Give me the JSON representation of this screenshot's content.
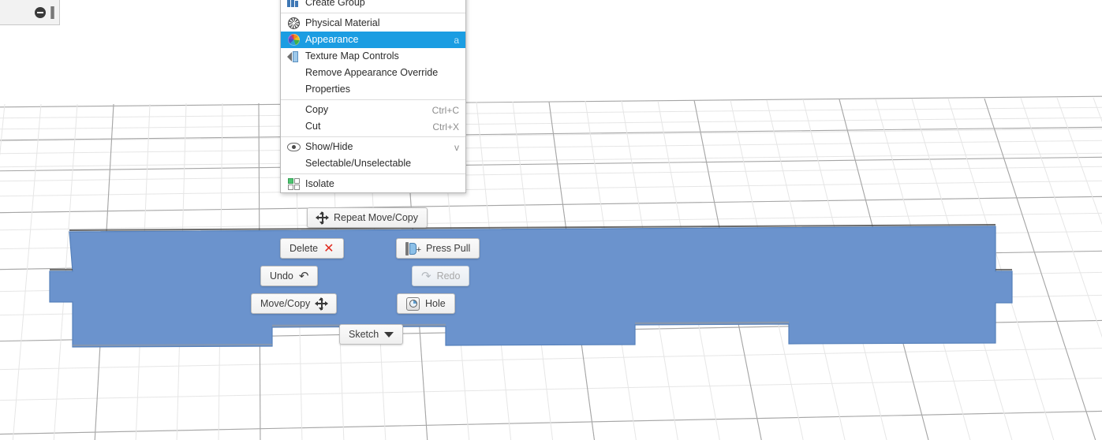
{
  "app": {
    "scene_background": "#ffffff",
    "body_fill": "#6b93cd",
    "body_edge": "#4a6fa5",
    "grid_minor_color": "#e3e3e3",
    "grid_major_color": "#9a9a9a",
    "accent_highlight": "#1b9de2"
  },
  "mini_toolbar": {
    "name": "selection-toolbar",
    "minus_icon": "minus-circle-icon",
    "caret_icon": "text-caret-icon"
  },
  "context_menu": {
    "name": "body-context-menu",
    "items": [
      {
        "label": "Create Group",
        "accel": "",
        "icon": "create-group-icon",
        "selected": false,
        "separator_after": true
      },
      {
        "label": "Physical Material",
        "accel": "",
        "icon": "physical-material-icon",
        "selected": false,
        "separator_after": false
      },
      {
        "label": "Appearance",
        "accel": "a",
        "icon": "appearance-icon",
        "selected": true,
        "separator_after": false
      },
      {
        "label": "Texture Map Controls",
        "accel": "",
        "icon": "texture-map-icon",
        "selected": false,
        "separator_after": false
      },
      {
        "label": "Remove Appearance Override",
        "accel": "",
        "icon": "",
        "selected": false,
        "separator_after": false
      },
      {
        "label": "Properties",
        "accel": "",
        "icon": "",
        "selected": false,
        "separator_after": true
      },
      {
        "label": "Copy",
        "accel": "Ctrl+C",
        "icon": "",
        "selected": false,
        "separator_after": false
      },
      {
        "label": "Cut",
        "accel": "Ctrl+X",
        "icon": "",
        "selected": false,
        "separator_after": true
      },
      {
        "label": "Show/Hide",
        "accel": "v",
        "icon": "eye-icon",
        "selected": false,
        "separator_after": false
      },
      {
        "label": "Selectable/Unselectable",
        "accel": "",
        "icon": "",
        "selected": false,
        "separator_after": true
      },
      {
        "label": "Isolate",
        "accel": "",
        "icon": "isolate-icon",
        "selected": false,
        "separator_after": false
      }
    ]
  },
  "marking_menu": {
    "name": "radial-action-buttons",
    "buttons": [
      {
        "label": "Repeat Move/Copy",
        "icon": "move-arrows-icon",
        "icon_side": "left",
        "disabled": false
      },
      {
        "label": "Delete",
        "icon": "red-x-icon",
        "icon_side": "right",
        "disabled": false
      },
      {
        "label": "Press Pull",
        "icon": "press-pull-icon",
        "icon_side": "left",
        "disabled": false
      },
      {
        "label": "Undo",
        "icon": "undo-arrow-icon",
        "icon_side": "right",
        "disabled": false
      },
      {
        "label": "Redo",
        "icon": "redo-arrow-icon",
        "icon_side": "left",
        "disabled": true
      },
      {
        "label": "Move/Copy",
        "icon": "move-arrows-icon",
        "icon_side": "right",
        "disabled": false
      },
      {
        "label": "Hole",
        "icon": "hole-icon",
        "icon_side": "left",
        "disabled": false
      },
      {
        "label": "Sketch",
        "icon": "chevron-down-icon",
        "icon_side": "right",
        "disabled": false
      }
    ]
  }
}
